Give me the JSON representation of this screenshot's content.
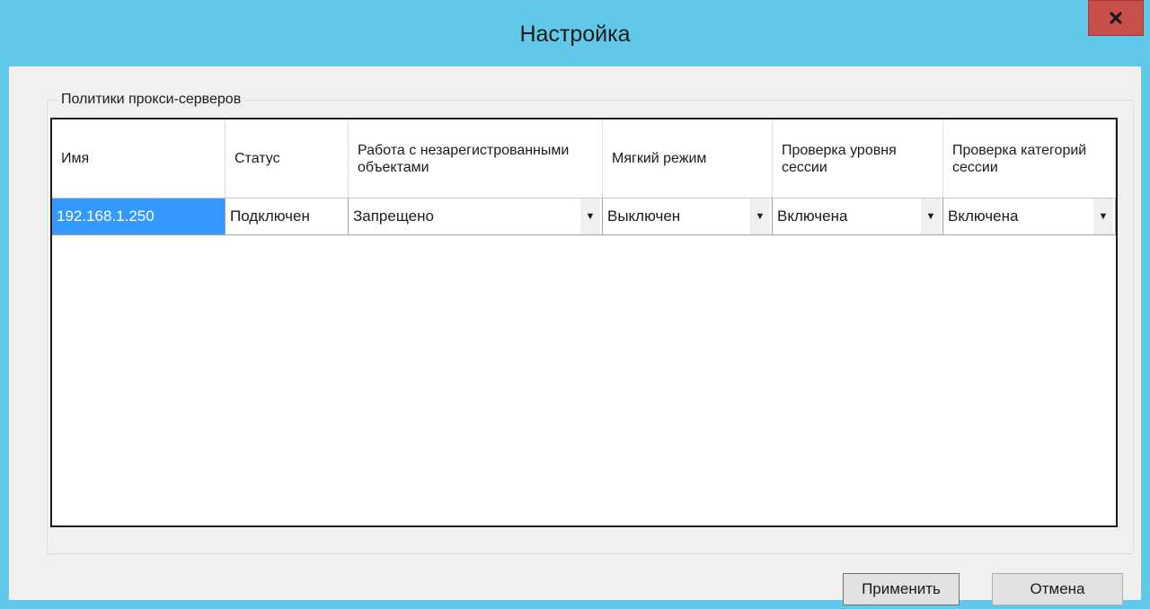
{
  "window": {
    "title": "Настройка",
    "close_label": "x"
  },
  "group": {
    "label": "Политики прокси-серверов"
  },
  "grid": {
    "columns": [
      {
        "label": "Имя"
      },
      {
        "label": "Статус"
      },
      {
        "label": "Работа с незарегистрованными объектами"
      },
      {
        "label": "Мягкий режим"
      },
      {
        "label": "Проверка уровня сессии"
      },
      {
        "label": "Проверка категорий сессии"
      }
    ],
    "rows": [
      {
        "name": "192.168.1.250",
        "status": "Подключен",
        "unregistered": "Запрещено",
        "soft_mode": "Выключен",
        "session_level": "Включена",
        "session_categories": "Включена"
      }
    ],
    "dropdown_arrow": "▼"
  },
  "buttons": {
    "apply": "Применить",
    "cancel": "Отмена"
  },
  "colors": {
    "titlebar": "#62c8ea",
    "close": "#c7504b",
    "selection": "#3399ff"
  }
}
